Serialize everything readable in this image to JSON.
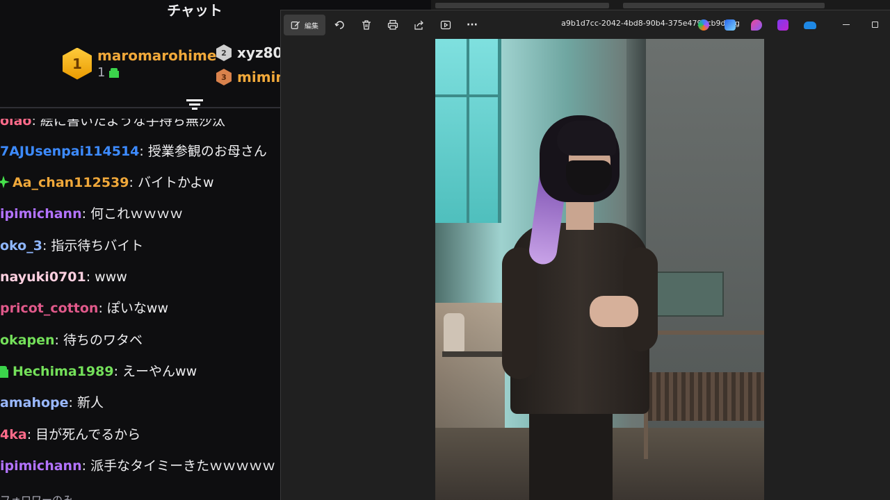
{
  "chat": {
    "title": "チャット",
    "top_gifters": [
      {
        "rank": "1",
        "name": "maromarohime",
        "count": "1",
        "name_color": "#f0a83a"
      },
      {
        "rank": "2",
        "name": "xyz80",
        "name_color": "#e8e8e8"
      },
      {
        "rank": "3",
        "name": "mimin",
        "name_color": "#f0a83a"
      }
    ],
    "messages": [
      {
        "user": "olao",
        "text": "絵に書いたような手持ち無沙汰",
        "color": "#ff6b8a"
      },
      {
        "user": "7AJUsenpai114514",
        "text": "授業参観のお母さん",
        "color": "#3d8bff"
      },
      {
        "user": "Aa_chan112539",
        "text": "バイトかよw",
        "color": "#f0a83a",
        "badge": "star"
      },
      {
        "user": "ipimichann",
        "text": "何これｗｗｗｗ",
        "color": "#b373ff"
      },
      {
        "user": "oko_3",
        "text": "指示待ちバイト",
        "color": "#8fb7ff"
      },
      {
        "user": "nayuki0701",
        "text": "www",
        "color": "#ffd0e0"
      },
      {
        "user": "pricot_cotton",
        "text": "ぽいなww",
        "color": "#e0598a"
      },
      {
        "user": "okapen",
        "text": "待ちのワタベ",
        "color": "#74e05a"
      },
      {
        "user": "Hechima1989",
        "text": "えーやんww",
        "color": "#74e05a",
        "badge": "gift"
      },
      {
        "user": "amahope",
        "text": "新人",
        "color": "#9ab8ff"
      },
      {
        "user": "4ka",
        "text": "目が死んでるから",
        "color": "#ff6b8a"
      },
      {
        "user": "ipimichann",
        "text": "派手なタイミーきたｗｗｗｗｗ",
        "color": "#b373ff"
      },
      {
        "user": "",
        "text": "フォロワーのみ",
        "color": "#adadb8"
      }
    ]
  },
  "viewer": {
    "edit_label": "編集",
    "filename": "a9b1d7cc-2042-4bd8-90b4-375e4796cb9d.jpg",
    "toolbar_icons": [
      "rotate-icon",
      "delete-icon",
      "print-icon",
      "share-icon",
      "slideshow-icon",
      "more-icon"
    ],
    "more_glyph": "···",
    "app_icons": [
      "copilot-icon",
      "designer-icon",
      "paint-icon",
      "clipchamp-icon",
      "onedrive-icon"
    ]
  }
}
